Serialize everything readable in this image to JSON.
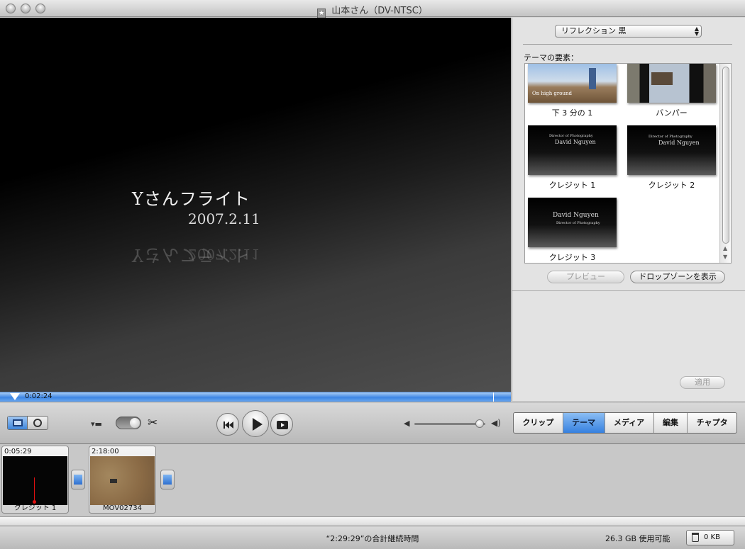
{
  "window": {
    "title": "山本さん（DV-NTSC）"
  },
  "viewer": {
    "title_text": "Yさんフライト",
    "date_text": "2007.2.11"
  },
  "scrubber": {
    "playhead_time": "0:02:24"
  },
  "panel": {
    "theme_popup": "リフレクション 黒",
    "elements_label": "テーマの要素：",
    "tiles": [
      {
        "label": "下 3 分の 1",
        "thumb_text": "On high ground"
      },
      {
        "label": "バンパー"
      },
      {
        "label": "クレジット 1",
        "thumb_line1": "Director of Photography",
        "thumb_line2": "David Nguyen"
      },
      {
        "label": "クレジット 2",
        "thumb_line1": "Director of Photography",
        "thumb_line2": "David Nguyen"
      },
      {
        "label": "クレジット 3",
        "thumb_line1": "David Nguyen",
        "thumb_line2": "Director of Photography"
      }
    ],
    "preview_button": "プレビュー",
    "dropzone_button": "ドロップゾーンを表示",
    "apply_button": "適用"
  },
  "controls": {
    "tabs": [
      {
        "label": "クリップ",
        "active": false
      },
      {
        "label": "テーマ",
        "active": true
      },
      {
        "label": "メディア",
        "active": false
      },
      {
        "label": "編集",
        "active": false
      },
      {
        "label": "チャプタ",
        "active": false
      }
    ],
    "volume_fraction": 0.98
  },
  "clips": [
    {
      "time": "0:05:29",
      "name": "クレジット 1"
    },
    {
      "time": "2:18:00",
      "name": "MOV02734"
    }
  ],
  "status": {
    "total_duration": "“2:29:29”の合計継続時間",
    "free_space": "26.3 GB 使用可能",
    "trash": "0 KB"
  },
  "colors": {
    "accent_blue": "#3f86dc",
    "scrubber_blue": "#3d86e4"
  }
}
